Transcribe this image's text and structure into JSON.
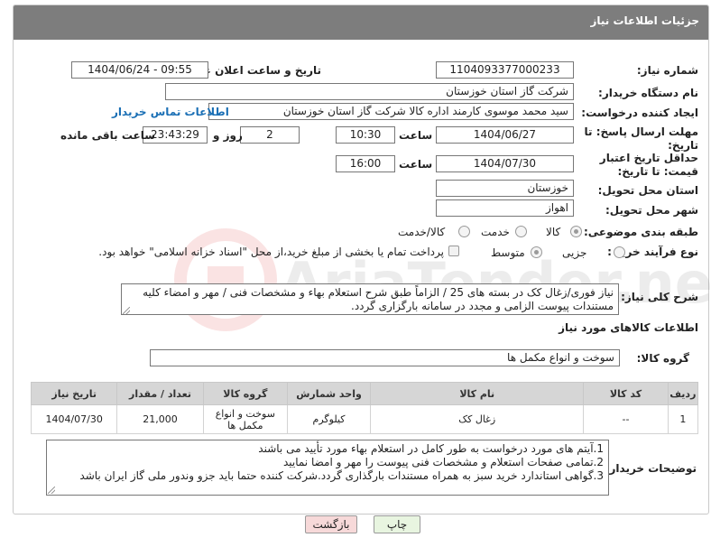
{
  "header": {
    "title": "جزئیات اطلاعات نیاز"
  },
  "form": {
    "need_number_label": "شماره نیاز:",
    "need_number": "1104093377000233",
    "announce_label": "تاریخ و ساعت اعلان عمومی:",
    "announce_value": "1404/06/24 - 09:55",
    "buyer_org_label": "نام دستگاه خریدار:",
    "buyer_org": "شرکت گاز استان خوزستان",
    "creator_label": "ایجاد کننده درخواست:",
    "creator": "سید محمد موسوی کارمند اداره کالا شرکت گاز استان خوزستان",
    "contact_link": "اطلاعات تماس خریدار",
    "reply_deadline_label": "مهلت ارسال پاسخ: تا تاریخ:",
    "reply_date": "1404/06/27",
    "time_label": "ساعت",
    "reply_time": "10:30",
    "days_value": "2",
    "days_label": "روز و",
    "remaining_time": "23:43:29",
    "remaining_label": "ساعت باقی مانده",
    "price_validity_label": "حداقل تاریخ اعتبار قیمت: تا تاریخ:",
    "price_date": "1404/07/30",
    "price_time": "16:00",
    "province_label": "استان محل تحویل:",
    "province": "خوزستان",
    "city_label": "شهر محل تحویل:",
    "city": "اهواز",
    "category_label": "طبقه بندی موضوعی:",
    "category_options": [
      "کالا",
      "خدمت",
      "کالا/خدمت"
    ],
    "category_selected": "کالا",
    "process_label": "نوع فرآیند خرید :",
    "process_options": [
      "جزیی",
      "متوسط"
    ],
    "process_selected": "متوسط",
    "payment_note": "پرداخت تمام یا بخشی از مبلغ خرید،از محل \"اسناد خزانه اسلامی\" خواهد بود.",
    "description_label": "شرح کلی نیاز:",
    "description": "نیاز فوری/زغال کک در بسته های 25 / الزاماً طبق شرح استعلام بهاء و مشخصات فنی / مهر و امضاء کلیه مستندات پیوست الزامی و مجدد در سامانه بارگزاری گردد."
  },
  "goods": {
    "section_title": "اطلاعات کالاهای مورد نیاز",
    "group_label": "گروه کالا:",
    "group_value": "سوخت و انواع مکمل ها",
    "columns": [
      "ردیف",
      "کد کالا",
      "نام کالا",
      "واحد شمارش",
      "گروه کالا",
      "تعداد / مقدار",
      "تاریخ نیاز"
    ],
    "rows": [
      {
        "row": "1",
        "code": "--",
        "name": "زغال کک",
        "unit": "کیلوگرم",
        "group": "سوخت و انواع مکمل ها",
        "qty": "21,000",
        "date": "1404/07/30"
      }
    ]
  },
  "buyer_notes": {
    "label": "توضیحات خریدار:",
    "lines": [
      "1.آیتم های مورد درخواست به طور کامل در استعلام بهاء مورد تأیید می باشند",
      "2.تمامی صفحات استعلام و مشخصات فنی پیوست را مهر و امضا نمایید",
      "3.گواهی استاندارد خرید سبز به همراه مستندات بارگذاری گردد.شرکت کننده حتما باید جزو وندور ملی گاز ایران باشد"
    ]
  },
  "buttons": {
    "print": "چاپ",
    "back": "بازگشت"
  },
  "watermark": {
    "text": "AriaTender.neT"
  },
  "colors": {
    "header_bg": "#7d7d7d",
    "link": "#1a6fb5",
    "back_btn_bg": "#f7d9d9",
    "print_btn_bg": "#e8f5e0"
  }
}
